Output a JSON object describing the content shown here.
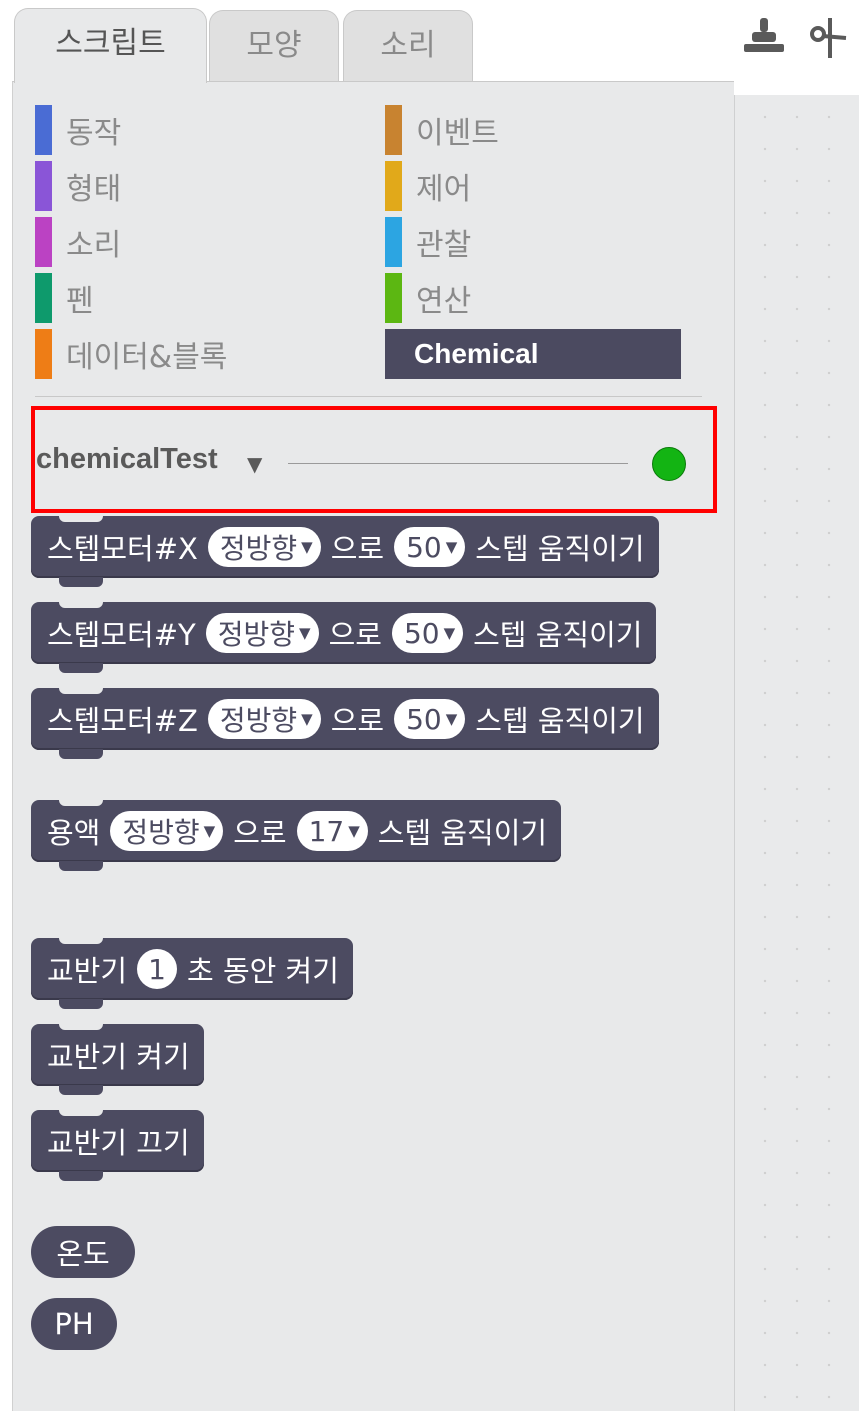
{
  "tabs": [
    {
      "label": "스크립트"
    },
    {
      "label": "모양"
    },
    {
      "label": "소리"
    }
  ],
  "toolbar": {
    "icons": [
      "stamp-icon",
      "scissors-icon"
    ]
  },
  "categories": {
    "left": [
      {
        "label": "동작",
        "color": "#4a6cd4"
      },
      {
        "label": "형태",
        "color": "#8a55d7"
      },
      {
        "label": "소리",
        "color": "#bb42c3"
      },
      {
        "label": "펜",
        "color": "#0e9a6c"
      },
      {
        "label": "데이터&블록",
        "color": "#ee7d16"
      }
    ],
    "right": [
      {
        "label": "이벤트",
        "color": "#c88330"
      },
      {
        "label": "제어",
        "color": "#e1a91a"
      },
      {
        "label": "관찰",
        "color": "#2ca5e2"
      },
      {
        "label": "연산",
        "color": "#5cb712"
      },
      {
        "label": "Chemical",
        "color": "#4b4a60"
      }
    ]
  },
  "extension": {
    "name": "chemicalTest",
    "status_color": "#13b413"
  },
  "blocks": {
    "stepper_x": {
      "prefix": "스텝모터#X",
      "direction": "정방향",
      "mid": "으로",
      "steps": "50",
      "suffix": "스텝  움직이기"
    },
    "stepper_y": {
      "prefix": "스텝모터#Y",
      "direction": "정방향",
      "mid": "으로",
      "steps": "50",
      "suffix": "스텝  움직이기"
    },
    "stepper_z": {
      "prefix": "스텝모터#Z",
      "direction": "정방향",
      "mid": "으로",
      "steps": "50",
      "suffix": "스텝  움직이기"
    },
    "solution": {
      "prefix": "용액",
      "direction": "정방향",
      "mid": "으로",
      "steps": "17",
      "suffix": "스텝  움직이기"
    },
    "mixer_timed": {
      "prefix": "교반기",
      "value": "1",
      "suffix": "초  동안  켜기"
    },
    "mixer_on": {
      "label": "교반기  켜기"
    },
    "mixer_off": {
      "label": "교반기  끄기"
    }
  },
  "reporters": [
    {
      "label": "온도"
    },
    {
      "label": "PH"
    }
  ],
  "colors": {
    "block": "#4c4b61",
    "palette_bg": "#e8e9ea",
    "highlight": "#ff0000"
  }
}
